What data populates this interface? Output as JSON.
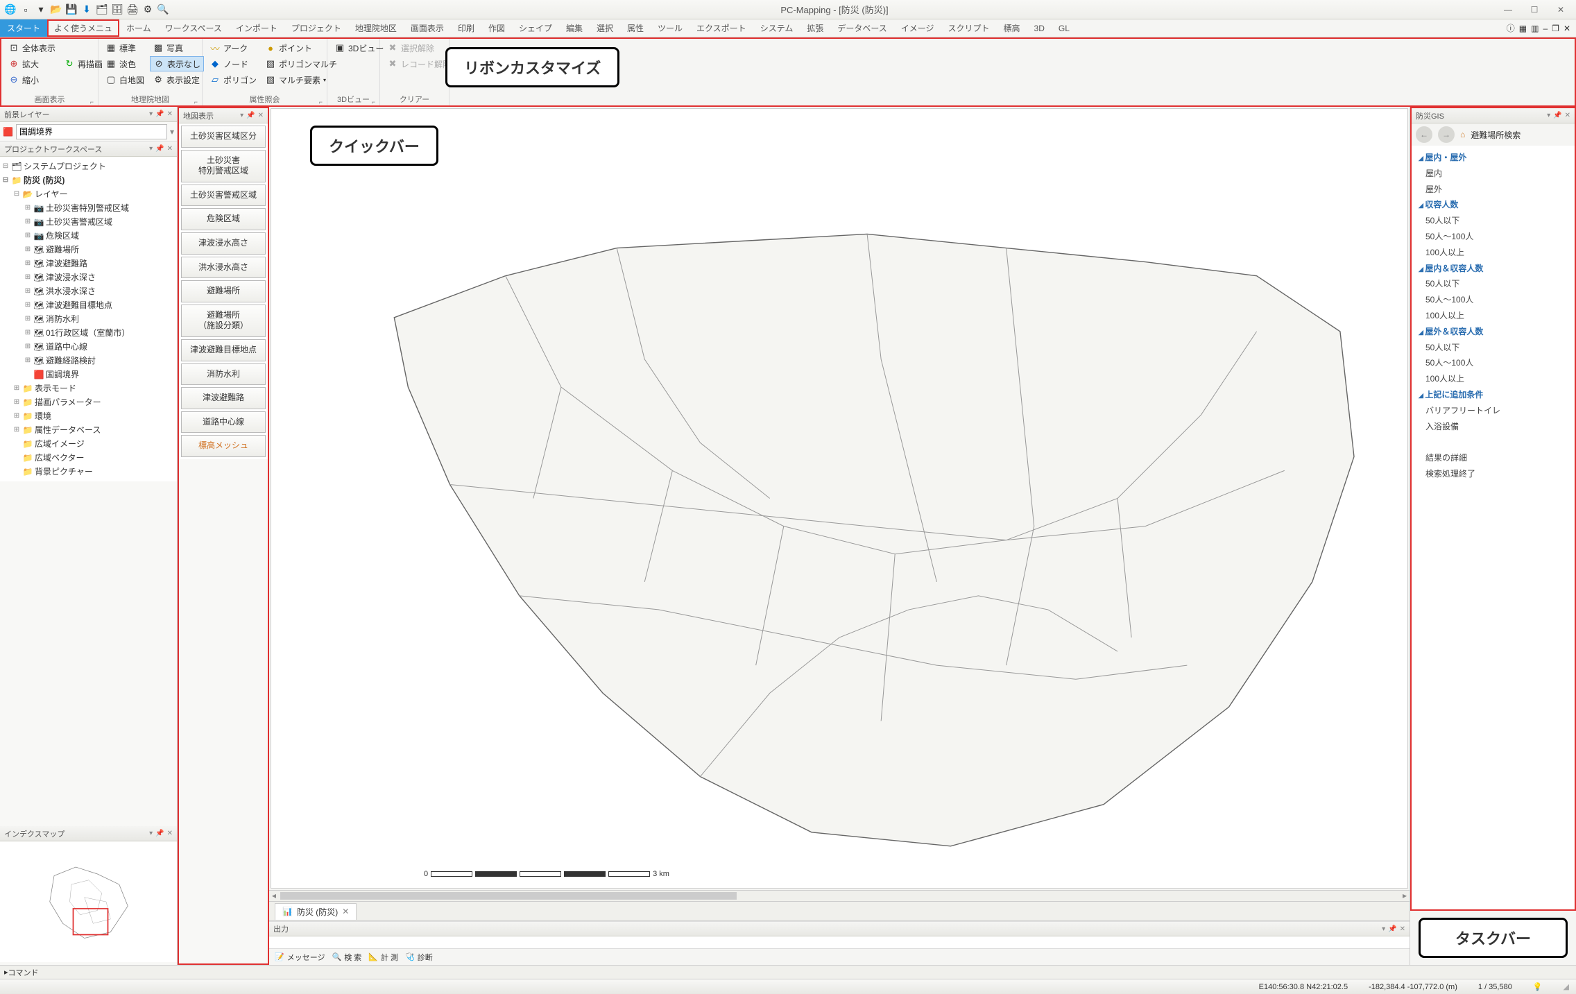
{
  "title": "PC-Mapping - [防災 (防災)]",
  "menu": {
    "start": "スタート",
    "tabs": [
      "よく使うメニュ",
      "ホーム",
      "ワークスペース",
      "インポート",
      "プロジェクト",
      "地理院地区",
      "画面表示",
      "印刷",
      "作図",
      "シェイプ",
      "編集",
      "選択",
      "属性",
      "ツール",
      "エクスポート",
      "システム",
      "拡張",
      "データベース",
      "イメージ",
      "スクリプト",
      "標高",
      "3D",
      "GL"
    ]
  },
  "ribbon": {
    "g1": {
      "label": "画面表示",
      "b": [
        "全体表示",
        "拡大",
        "再描画",
        "縮小"
      ]
    },
    "g2": {
      "label": "地理院地図",
      "b": [
        "標準",
        "写真",
        "淡色",
        "表示なし",
        "白地図",
        "表示設定"
      ]
    },
    "g3": {
      "label": "属性照会",
      "b": [
        "アーク",
        "ポイント",
        "ノード",
        "ポリゴンマルチ",
        "ポリゴン",
        "マルチ要素"
      ]
    },
    "g4": {
      "label": "3Dビュー",
      "b": [
        "3Dビュー"
      ]
    },
    "g5": {
      "label": "クリアー",
      "b": [
        "選択解除",
        "レコード解除"
      ]
    }
  },
  "callouts": {
    "ribbon": "リボンカスタマイズ",
    "quick": "クイックバー",
    "task": "タスクバー"
  },
  "panels": {
    "fgLayer": {
      "title": "前景レイヤー",
      "value": "国調境界"
    },
    "ws": {
      "title": "プロジェクトワークスペース"
    },
    "indexmap": {
      "title": "インデクスマップ"
    },
    "mapdisp": {
      "title": "地図表示"
    },
    "gis": {
      "title": "防災GIS",
      "nav": "避難場所検索"
    },
    "output": {
      "title": "出力"
    }
  },
  "tree": [
    {
      "d": 0,
      "tw": "⊟",
      "ic": "🗂",
      "t": "システムプロジェクト"
    },
    {
      "d": 0,
      "tw": "⊟",
      "ic": "📁",
      "t": "防災 (防災)",
      "b": true
    },
    {
      "d": 1,
      "tw": "⊟",
      "ic": "📂",
      "t": "レイヤー"
    },
    {
      "d": 2,
      "tw": "⊞",
      "ic": "📷",
      "t": "土砂災害特別警戒区域"
    },
    {
      "d": 2,
      "tw": "⊞",
      "ic": "📷",
      "t": "土砂災害警戒区域"
    },
    {
      "d": 2,
      "tw": "⊞",
      "ic": "📷",
      "t": "危険区域"
    },
    {
      "d": 2,
      "tw": "⊞",
      "ic": "🗺",
      "t": "避難場所"
    },
    {
      "d": 2,
      "tw": "⊞",
      "ic": "🗺",
      "t": "津波避難路"
    },
    {
      "d": 2,
      "tw": "⊞",
      "ic": "🗺",
      "t": "津波浸水深さ"
    },
    {
      "d": 2,
      "tw": "⊞",
      "ic": "🗺",
      "t": "洪水浸水深さ"
    },
    {
      "d": 2,
      "tw": "⊞",
      "ic": "🗺",
      "t": "津波避難目標地点"
    },
    {
      "d": 2,
      "tw": "⊞",
      "ic": "🗺",
      "t": "消防水利"
    },
    {
      "d": 2,
      "tw": "⊞",
      "ic": "🗺",
      "t": "01行政区域（室蘭市）"
    },
    {
      "d": 2,
      "tw": "⊞",
      "ic": "🗺",
      "t": "道路中心線"
    },
    {
      "d": 2,
      "tw": "⊞",
      "ic": "🗺",
      "t": "避難経路検討"
    },
    {
      "d": 2,
      "tw": "",
      "ic": "🟥",
      "t": "国調境界"
    },
    {
      "d": 1,
      "tw": "⊞",
      "ic": "📁",
      "t": "表示モード"
    },
    {
      "d": 1,
      "tw": "⊞",
      "ic": "📁",
      "t": "描画パラメーター"
    },
    {
      "d": 1,
      "tw": "⊞",
      "ic": "📁",
      "t": "環境"
    },
    {
      "d": 1,
      "tw": "⊞",
      "ic": "📁",
      "t": "属性データベース"
    },
    {
      "d": 1,
      "tw": "",
      "ic": "📁",
      "t": "広域イメージ"
    },
    {
      "d": 1,
      "tw": "",
      "ic": "📁",
      "t": "広域ベクター"
    },
    {
      "d": 1,
      "tw": "",
      "ic": "📁",
      "t": "背景ピクチャー"
    }
  ],
  "mapdisp_buttons": [
    "土砂災害区域区分",
    "土砂災害\n特別警戒区域",
    "土砂災害警戒区域",
    "危険区域",
    "津波浸水高さ",
    "洪水浸水高さ",
    "避難場所",
    "避難場所\n（施設分類）",
    "津波避難目標地点",
    "消防水利",
    "津波避難路",
    "道路中心線",
    "標高メッシュ"
  ],
  "gis": {
    "sections": [
      {
        "h": "屋内・屋外",
        "items": [
          "屋内",
          "屋外"
        ]
      },
      {
        "h": "収容人数",
        "items": [
          "50人以下",
          "50人～100人",
          "100人以上"
        ]
      },
      {
        "h": "屋内＆収容人数",
        "items": [
          "50人以下",
          "50人～100人",
          "100人以上"
        ]
      },
      {
        "h": "屋外＆収容人数",
        "items": [
          "50人以下",
          "50人～100人",
          "100人以上"
        ]
      },
      {
        "h": "上記に追加条件",
        "items": [
          "バリアフリートイレ",
          "入浴設備"
        ]
      }
    ],
    "footer": [
      "結果の詳細",
      "検索処理終了"
    ]
  },
  "maptab": "防災 (防災)",
  "output_tabs": [
    "メッセージ",
    "検 索",
    "計 測",
    "診断"
  ],
  "cmd": "コマンド",
  "status": {
    "lonlat": "E140:56:30.8 N42:21:02.5",
    "xy": "-182,384.4 -107,772.0 (m)",
    "scale": "1 / 35,580"
  },
  "scalebar": {
    "start": "0",
    "end": "3 km"
  }
}
